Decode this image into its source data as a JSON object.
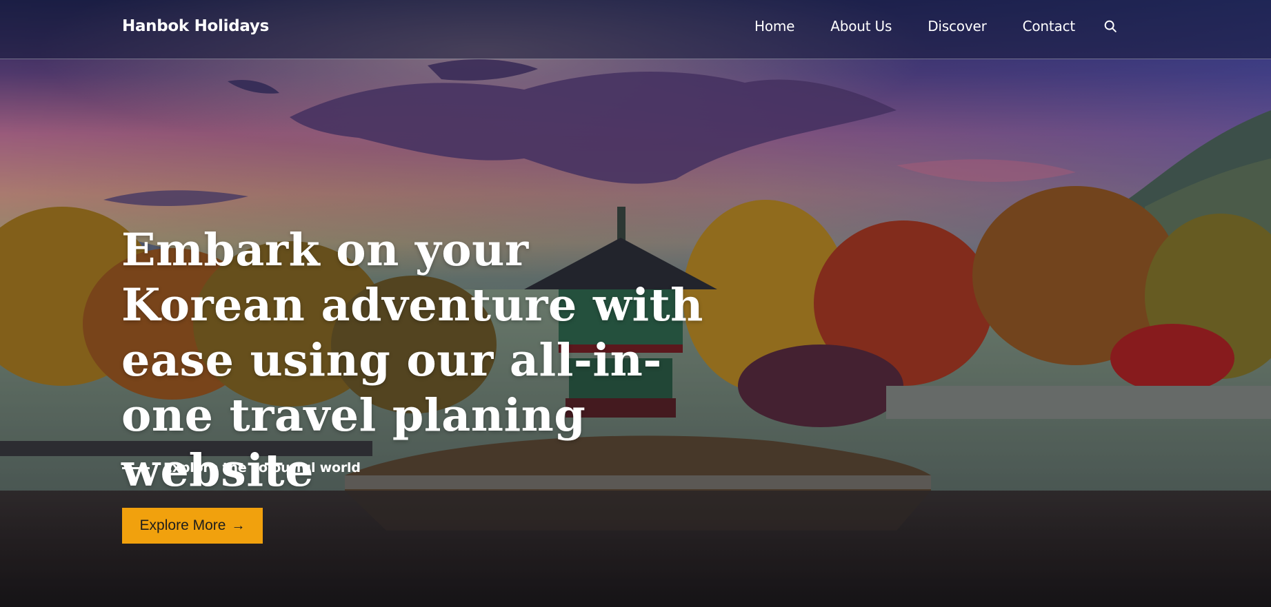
{
  "brand": {
    "name": "Hanbok Holidays"
  },
  "nav": {
    "items": [
      {
        "label": "Home"
      },
      {
        "label": "About Us"
      },
      {
        "label": "Discover"
      },
      {
        "label": "Contact"
      }
    ],
    "search_icon": "search-icon"
  },
  "hero": {
    "headline": "Embark on your Korean adventure with ease using our all-in-one travel planing website",
    "subtitle": "Explore the colourful world",
    "cta_label": "Explore More",
    "cta_icon": "arrow-right-icon",
    "cta_icon_glyph": "→"
  },
  "colors": {
    "accent": "#f1a10d",
    "navbar": "#161a3a",
    "text": "#ffffff"
  }
}
